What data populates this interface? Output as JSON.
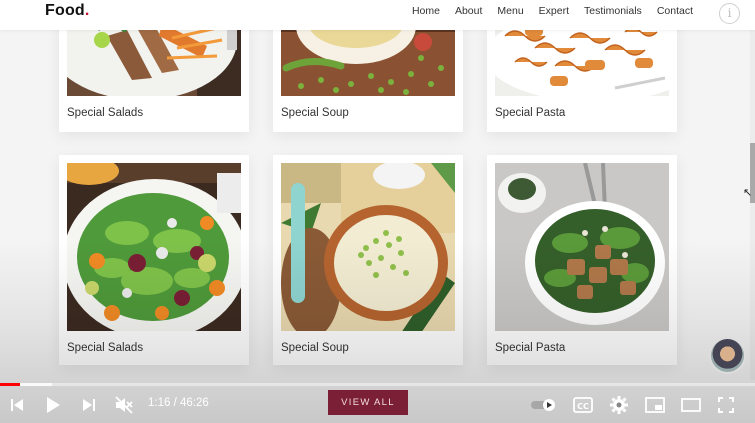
{
  "brand": {
    "name": "Food",
    "dot": "."
  },
  "nav": {
    "items": [
      "Home",
      "About",
      "Menu",
      "Expert",
      "Testimonials",
      "Contact"
    ]
  },
  "cards": [
    {
      "title": "Special Salads"
    },
    {
      "title": "Special Soup"
    },
    {
      "title": "Special Pasta"
    },
    {
      "title": "Special Salads"
    },
    {
      "title": "Special Soup"
    },
    {
      "title": "Special Pasta"
    }
  ],
  "cta": {
    "label": "VIEW ALL"
  },
  "player": {
    "time": "1:16 / 46:26",
    "progress": {
      "played_fraction": 0.027,
      "buffered_fraction": 0.069
    },
    "accent_color": "#ff0000"
  },
  "colors": {
    "brand_red": "#c8102e",
    "button": "#7a1f35"
  }
}
